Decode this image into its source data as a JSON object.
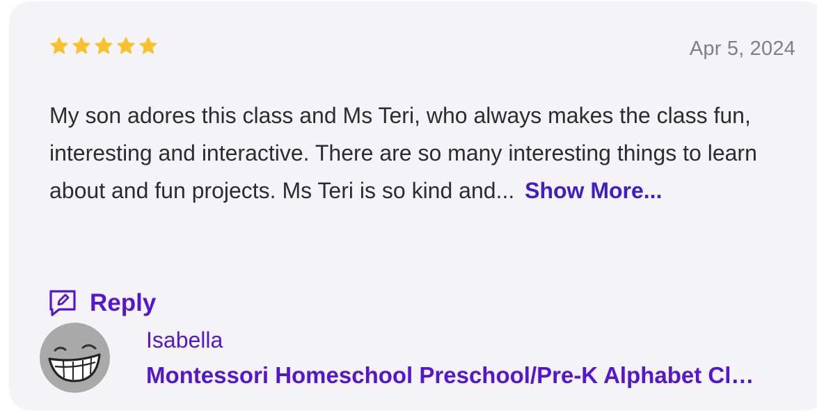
{
  "review": {
    "rating": 5,
    "max_rating": 5,
    "star_color": "#fbc02d",
    "date": "Apr 5, 2024",
    "text": "My son adores this class and Ms Teri, who always makes the class fun, interesting and interactive. There are so many interesting things to learn about and fun projects. Ms Teri is so kind and...",
    "show_more_label": "Show More...",
    "reply_label": "Reply",
    "author": "Isabella",
    "class_title": "Montessori Homeschool Preschool/Pre-K Alphabet Class",
    "avatar_icon": "smiley-avatar-icon",
    "reply_icon": "chat-edit-icon"
  },
  "colors": {
    "card_background": "#f4f3f7",
    "accent": "#5416cf",
    "link": "#3f1fc1",
    "date_text": "#808080",
    "body_text": "#2c2c2c"
  }
}
